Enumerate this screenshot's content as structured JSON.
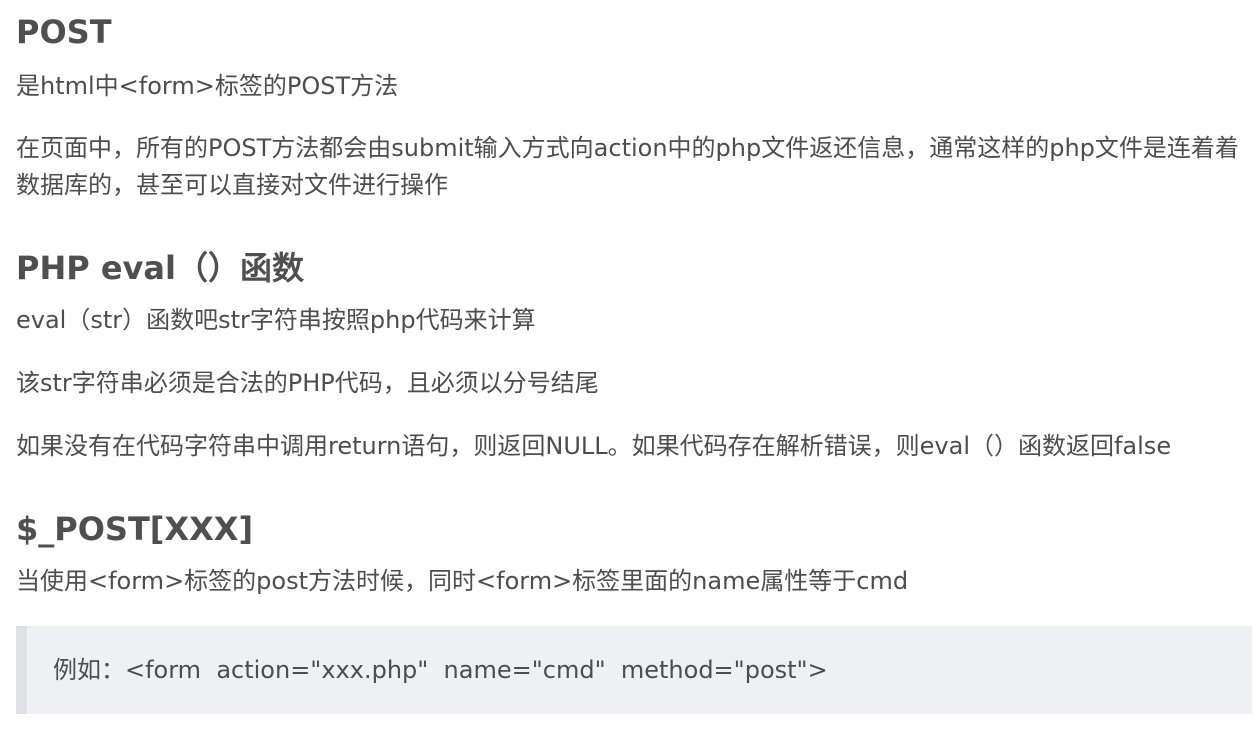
{
  "sections": {
    "post": {
      "heading": "POST",
      "p1": "是html中<form>标签的POST方法",
      "p2": "在页面中，所有的POST方法都会由submit输入方式向action中的php文件返还信息，通常这样的php文件是连着着数据库的，甚至可以直接对文件进行操作"
    },
    "eval": {
      "heading": "PHP eval（）函数",
      "p1": "eval（str）函数吧str字符串按照php代码来计算",
      "p2": "该str字符串必须是合法的PHP代码，且必须以分号结尾",
      "p3": "如果没有在代码字符串中调用return语句，则返回NULL。如果代码存在解析错误，则eval（）函数返回false"
    },
    "post_var": {
      "heading": "$_POST[XXX]",
      "p1": "当使用<form>标签的post方法时候，同时<form>标签里面的name属性等于cmd",
      "quote": "例如：<form  action=\"xxx.php\"  name=\"cmd\"  method=\"post\">"
    }
  }
}
